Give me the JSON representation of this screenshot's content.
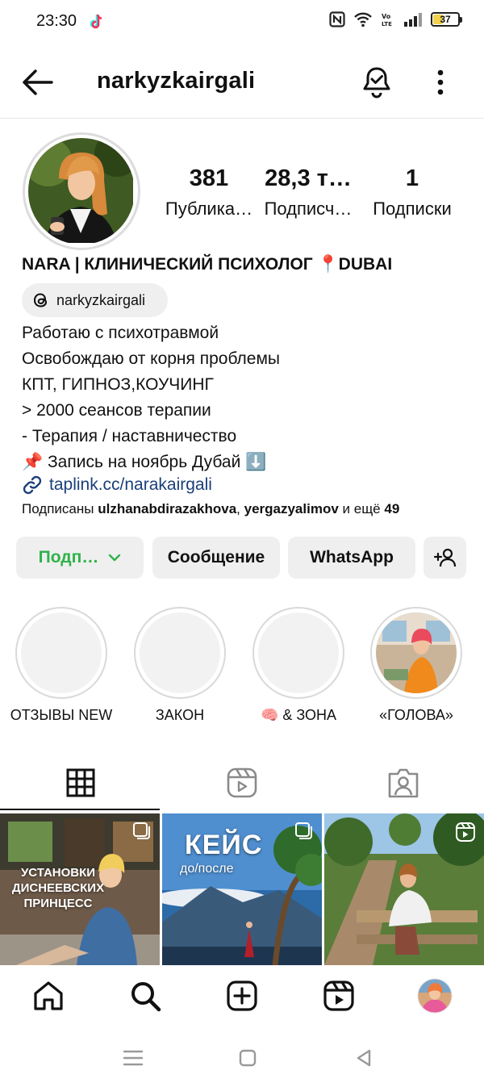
{
  "status_bar": {
    "time": "23:30",
    "battery": "37",
    "battery_level": 0.37,
    "icons": [
      "tiktok-icon",
      "nfc-icon",
      "wifi-icon",
      "volte-icon",
      "signal-icon",
      "battery-icon"
    ]
  },
  "header": {
    "username": "narkyzkairgali"
  },
  "profile": {
    "stats": [
      {
        "value": "381",
        "label": "Публика…"
      },
      {
        "value": "28,3 т…",
        "label": "Подписч…"
      },
      {
        "value": "1",
        "label": "Подписки"
      }
    ],
    "full_name": "NARA | КЛИНИЧЕСКИЙ ПСИХОЛОГ 📍DUBAI",
    "threads_handle": "narkyzkairgali",
    "bio": [
      "Работаю с психотравмой",
      "Освобождаю от корня проблемы",
      "КПТ, ГИПНОЗ,КОУЧИНГ",
      "> 2000 сеансов терапии",
      "- Терапия / наставничество",
      "📌 Запись на ноябрь Дубай ⬇️"
    ],
    "link": "taplink.cc/narakairgali",
    "followed_by": {
      "prefix": "Подписаны ",
      "user1": "ulzhanabdirazakhova",
      "separator": ", ",
      "user2": "yergazyalimov",
      "suffix": " и ещё ",
      "count": "49"
    }
  },
  "buttons": {
    "follow": "Подп…",
    "message": "Сообщение",
    "whatsapp": "WhatsApp"
  },
  "highlights": [
    {
      "label": "ОТЗЫВЫ NEW"
    },
    {
      "label": "ЗАКОН"
    },
    {
      "label": "🧠 & ЗОНА"
    },
    {
      "label": "«ГОЛОВА»"
    }
  ],
  "posts": [
    {
      "text": "УСТАНОВКИ ДИСНЕЕВСКИХ ПРИНЦЕСС"
    },
    {
      "title": "КЕЙС",
      "subtitle": "до/после"
    },
    {}
  ],
  "colors": {
    "follow_green": "#2fb34a",
    "link_blue": "#1a3f7a",
    "button_bg": "#efefef"
  }
}
